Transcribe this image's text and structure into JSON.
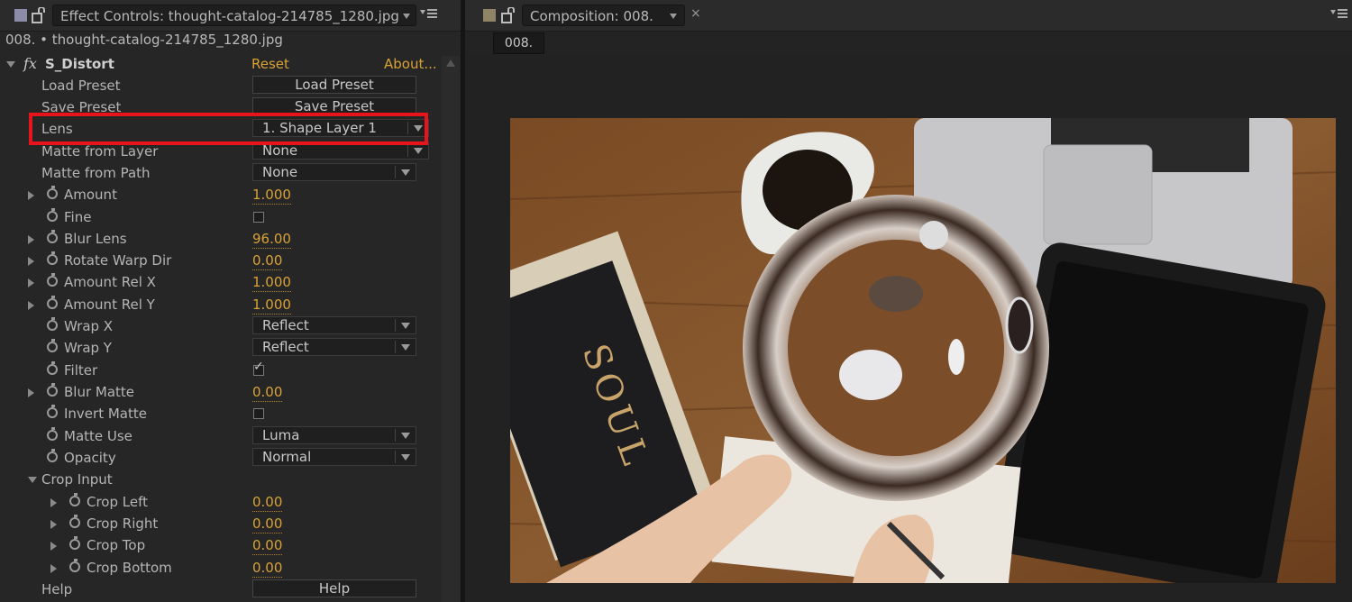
{
  "effect_controls": {
    "tab_title": "Effect Controls: thought-catalog-214785_1280.jpg",
    "layer_path": "008. • thought-catalog-214785_1280.jpg",
    "effect_name": "S_Distort",
    "reset_label": "Reset",
    "about_label": "About...",
    "params": {
      "load_preset": {
        "label": "Load Preset",
        "button": "Load Preset"
      },
      "save_preset": {
        "label": "Save Preset",
        "button": "Save Preset"
      },
      "lens": {
        "label": "Lens",
        "value": "1. Shape Layer 1"
      },
      "matte_from_layer": {
        "label": "Matte from Layer",
        "value": "None"
      },
      "matte_from_path": {
        "label": "Matte from Path",
        "value": "None"
      },
      "amount": {
        "label": "Amount",
        "value": "1.000"
      },
      "fine": {
        "label": "Fine",
        "checked": false
      },
      "blur_lens": {
        "label": "Blur Lens",
        "value": "96.00"
      },
      "rotate_warp_dir": {
        "label": "Rotate Warp Dir",
        "value": "0.00"
      },
      "amount_rel_x": {
        "label": "Amount Rel X",
        "value": "1.000"
      },
      "amount_rel_y": {
        "label": "Amount Rel Y",
        "value": "1.000"
      },
      "wrap_x": {
        "label": "Wrap X",
        "value": "Reflect"
      },
      "wrap_y": {
        "label": "Wrap Y",
        "value": "Reflect"
      },
      "filter": {
        "label": "Filter",
        "checked": true
      },
      "blur_matte": {
        "label": "Blur Matte",
        "value": "0.00"
      },
      "invert_matte": {
        "label": "Invert Matte",
        "checked": false
      },
      "matte_use": {
        "label": "Matte Use",
        "value": "Luma"
      },
      "opacity": {
        "label": "Opacity",
        "value": "Normal"
      },
      "crop_input": {
        "label": "Crop Input"
      },
      "crop_left": {
        "label": "Crop Left",
        "value": "0.00"
      },
      "crop_right": {
        "label": "Crop Right",
        "value": "0.00"
      },
      "crop_top": {
        "label": "Crop Top",
        "value": "0.00"
      },
      "crop_bottom": {
        "label": "Crop Bottom",
        "value": "0.00"
      },
      "help": {
        "label": "Help",
        "button": "Help"
      }
    }
  },
  "composition": {
    "tab_title": "Composition: 008.",
    "comp_tab": "008.",
    "book_text": "SOUL"
  },
  "colors": {
    "accent_value": "#d9a236",
    "highlight": "#e8141c",
    "panel_bg": "#262626"
  }
}
